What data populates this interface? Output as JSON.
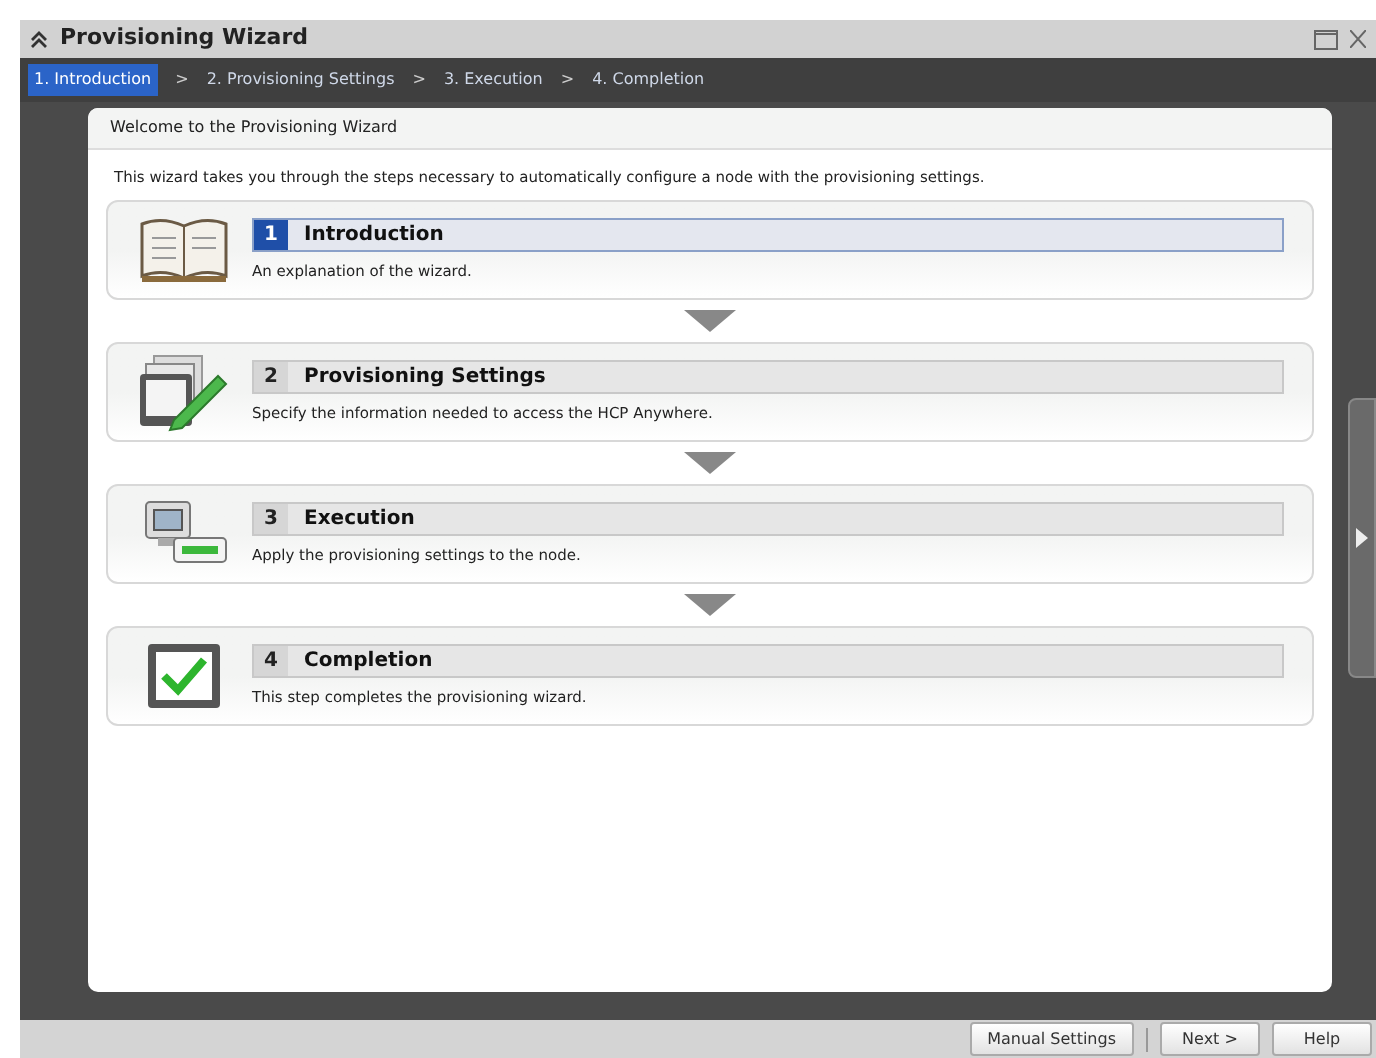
{
  "window": {
    "title": "Provisioning Wizard"
  },
  "breadcrumbs": [
    {
      "label": "1. Introduction",
      "selected": true
    },
    {
      "label": "2. Provisioning Settings",
      "selected": false
    },
    {
      "label": "3. Execution",
      "selected": false
    },
    {
      "label": "4. Completion",
      "selected": false
    }
  ],
  "breadcrumb_separator": ">",
  "panel": {
    "title": "Welcome to the Provisioning Wizard",
    "intro": "This wizard takes you through the steps necessary to automatically configure a node with the provisioning settings."
  },
  "steps": [
    {
      "kind": "book",
      "number": "1",
      "title": "Introduction",
      "description": "An explanation of the wizard.",
      "selected": true
    },
    {
      "kind": "edit",
      "number": "2",
      "title": "Provisioning Settings",
      "description": "Specify the information needed to access the HCP Anywhere.",
      "selected": false
    },
    {
      "kind": "computer",
      "number": "3",
      "title": "Execution",
      "description": "Apply the provisioning settings to the node.",
      "selected": false
    },
    {
      "kind": "check",
      "number": "4",
      "title": "Completion",
      "description": "This step completes the provisioning wizard.",
      "selected": false
    }
  ],
  "buttons": [
    "Manual Settings",
    "Next >",
    "Help"
  ]
}
